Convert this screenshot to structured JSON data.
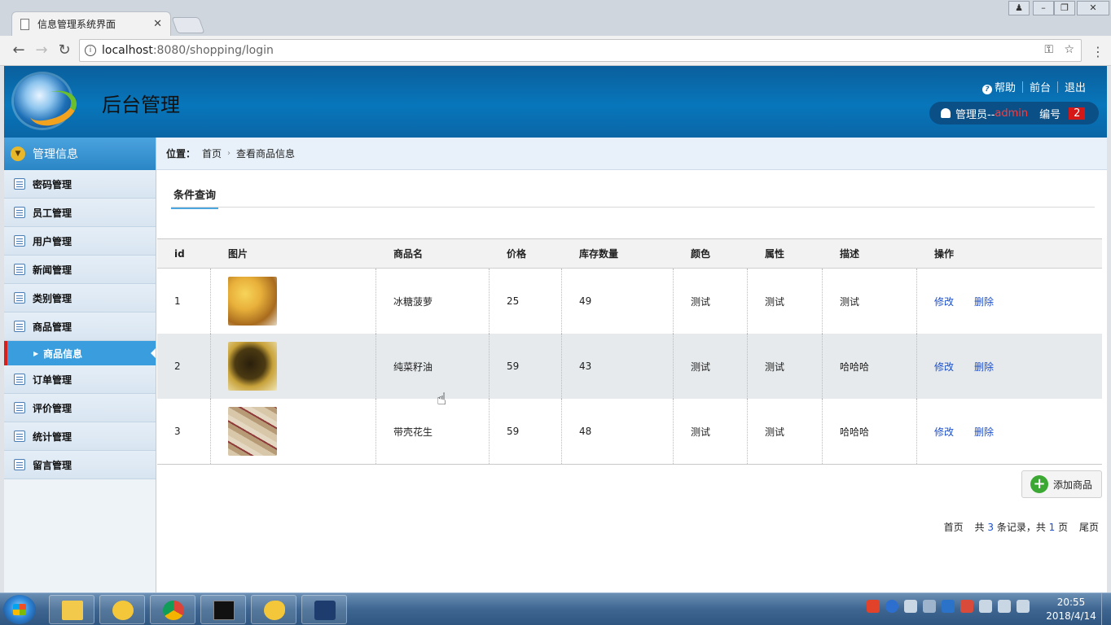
{
  "browser": {
    "tab_title": "信息管理系统界面",
    "tab_close": "✕",
    "url_host": "localhost",
    "url_path": ":8080/shopping/login"
  },
  "header": {
    "title": "后台管理",
    "links": {
      "help": "帮助",
      "front": "前台",
      "logout": "退出"
    },
    "user_label": "管理员--",
    "user_name": "admin",
    "id_label": "编号",
    "id_value": "2"
  },
  "sidebar": {
    "heading": "管理信息",
    "items": [
      {
        "label": "密码管理"
      },
      {
        "label": "员工管理"
      },
      {
        "label": "用户管理"
      },
      {
        "label": "新闻管理"
      },
      {
        "label": "类别管理"
      },
      {
        "label": "商品管理"
      }
    ],
    "sub_item": "商品信息",
    "items_after": [
      {
        "label": "订单管理"
      },
      {
        "label": "评价管理"
      },
      {
        "label": "统计管理"
      },
      {
        "label": "留言管理"
      }
    ]
  },
  "breadcrumb": {
    "pos_label": "位置：",
    "home": "首页",
    "current": "查看商品信息"
  },
  "query_tab": "条件查询",
  "table": {
    "headers": [
      "id",
      "图片",
      "商品名",
      "价格",
      "库存数量",
      "颜色",
      "属性",
      "描述",
      "操作"
    ],
    "rows": [
      {
        "id": "1",
        "image": "pineapple",
        "name": "冰糖菠萝",
        "price": "25",
        "stock": "49",
        "color": "测试",
        "attr": "测试",
        "desc": "测试"
      },
      {
        "id": "2",
        "image": "rapeseed-oil",
        "name": "纯菜籽油",
        "price": "59",
        "stock": "43",
        "color": "测试",
        "attr": "测试",
        "desc": "哈哈哈"
      },
      {
        "id": "3",
        "image": "peanuts",
        "name": "带壳花生",
        "price": "59",
        "stock": "48",
        "color": "测试",
        "attr": "测试",
        "desc": "哈哈哈"
      }
    ],
    "edit_label": "修改",
    "delete_label": "删除"
  },
  "add_button": "添加商品",
  "pager": {
    "first": "首页",
    "total_prefix": "共",
    "total_count": "3",
    "total_suffix": "条记录，共",
    "pages": "1",
    "pages_suffix": "页",
    "last": "尾页"
  },
  "taskbar": {
    "time": "20:55",
    "date": "2018/4/14"
  }
}
